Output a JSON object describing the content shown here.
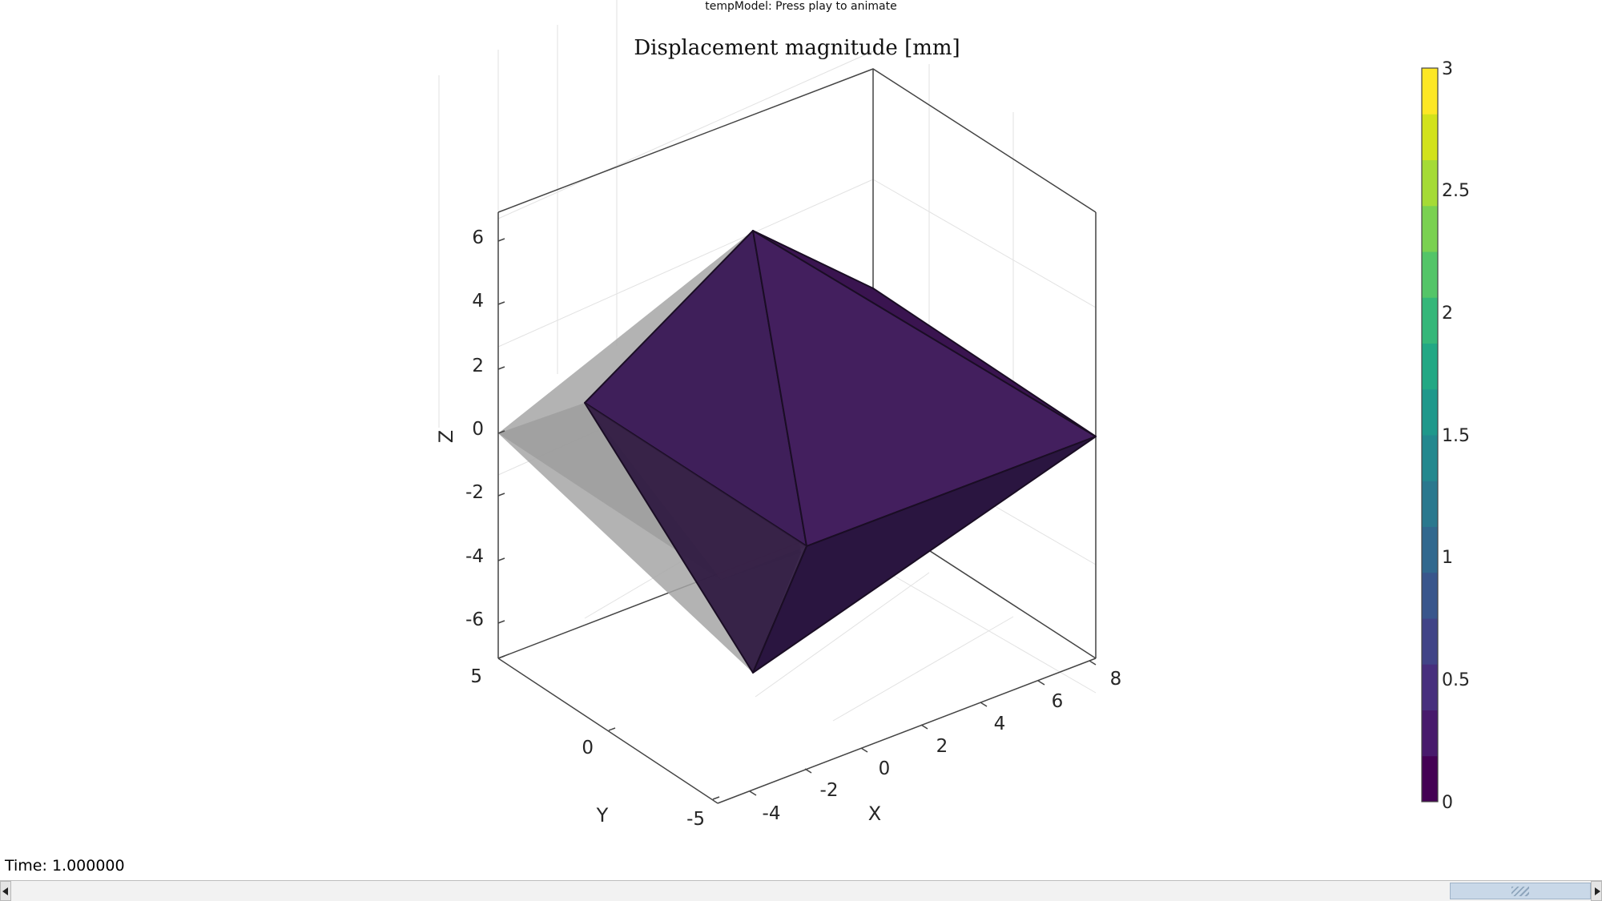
{
  "window": {
    "title": "tempModel: Press play to animate"
  },
  "plot": {
    "title": "Displacement magnitude [mm]",
    "axis_labels": {
      "x": "X",
      "y": "Y",
      "z": "Z"
    },
    "x_ticks": [
      "-4",
      "-2",
      "0",
      "2",
      "4",
      "6",
      "8"
    ],
    "y_ticks": [
      "-5",
      "0",
      "5"
    ],
    "z_ticks": [
      "-6",
      "-4",
      "-2",
      "0",
      "2",
      "4",
      "6"
    ],
    "colors": {
      "surface_dark": "#2b1540",
      "surface_mid": "#3b1c5a",
      "surface_light": "#4a235f",
      "reference_shape": "#a6a6a6",
      "axes": "#444444",
      "grid": "#e2e2e2"
    }
  },
  "colorbar": {
    "ticks": [
      "0",
      "0.5",
      "1",
      "1.5",
      "2",
      "2.5",
      "3"
    ],
    "range": [
      0,
      3
    ],
    "colormap": "viridis",
    "bands": [
      "#440154",
      "#481a6c",
      "#472f7d",
      "#414487",
      "#39568c",
      "#31688e",
      "#2a788e",
      "#23888e",
      "#1f988b",
      "#22a884",
      "#35b779",
      "#54c568",
      "#7ad151",
      "#a5db36",
      "#d2e21b",
      "#fde725"
    ]
  },
  "status": {
    "time_text": "Time: 1.000000"
  },
  "scrollbar": {
    "position_fraction": 1.0
  }
}
